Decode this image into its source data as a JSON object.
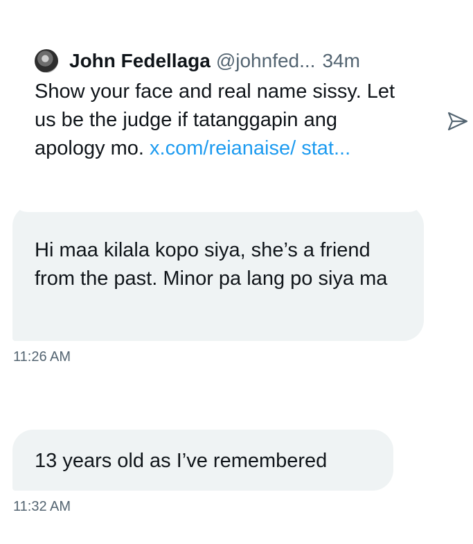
{
  "quoted_tweet": {
    "author_name": "John Fedellaga",
    "author_handle": "@johnfed...",
    "time_ago": "34m",
    "text": "Show your face and real name sissy. Let us be the judge if tatanggapin ang apology mo. ",
    "link": "x.com/reianaise/ stat..."
  },
  "messages": [
    {
      "text": "Hi maa kilala kopo siya, she’s a friend from the past. Minor pa lang po siya ma",
      "timestamp": "11:26 AM"
    },
    {
      "text": "13 years old as I’ve remembered",
      "timestamp": "11:32 AM"
    }
  ],
  "icons": {
    "share": "share-icon"
  },
  "colors": {
    "background": "#ffffff",
    "bubble": "#eff3f4",
    "link": "#1d9bf0",
    "secondary_text": "#536471",
    "primary_text": "#0f1419"
  }
}
